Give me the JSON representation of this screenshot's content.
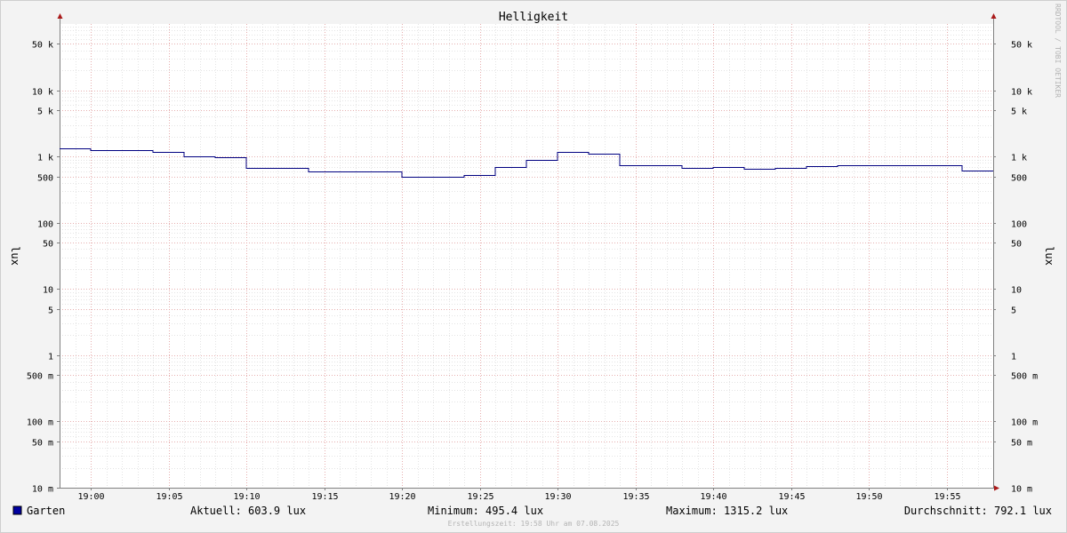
{
  "chart_data": {
    "type": "line",
    "title": "Helligkeit",
    "ylabel": "lux",
    "ylabel_right": "lux",
    "yscale": "log",
    "ylim": [
      0.01,
      100000
    ],
    "xlim": [
      "18:58",
      "19:58"
    ],
    "grid": true,
    "y_ticks": [
      {
        "value": 50000,
        "label": "50 k"
      },
      {
        "value": 10000,
        "label": "10 k"
      },
      {
        "value": 5000,
        "label": "5 k"
      },
      {
        "value": 1000,
        "label": "1 k"
      },
      {
        "value": 500,
        "label": "500"
      },
      {
        "value": 100,
        "label": "100"
      },
      {
        "value": 50,
        "label": "50"
      },
      {
        "value": 10,
        "label": "10"
      },
      {
        "value": 5,
        "label": "5"
      },
      {
        "value": 1,
        "label": "1"
      },
      {
        "value": 0.5,
        "label": "500 m"
      },
      {
        "value": 0.1,
        "label": "100 m"
      },
      {
        "value": 0.05,
        "label": "50 m"
      },
      {
        "value": 0.01,
        "label": "10 m"
      }
    ],
    "x_ticks": [
      "19:00",
      "19:05",
      "19:10",
      "19:15",
      "19:20",
      "19:25",
      "19:30",
      "19:35",
      "19:40",
      "19:45",
      "19:50",
      "19:55"
    ],
    "series": [
      {
        "name": "Garten",
        "color": "#000080",
        "x": [
          "18:58",
          "19:00",
          "19:04",
          "19:06",
          "19:08",
          "19:10",
          "19:14",
          "19:20",
          "19:24",
          "19:26",
          "19:28",
          "19:30",
          "19:32",
          "19:34",
          "19:38",
          "19:40",
          "19:42",
          "19:44",
          "19:46",
          "19:48",
          "19:50",
          "19:52",
          "19:54",
          "19:56"
        ],
        "values": [
          1315.2,
          1240,
          1170,
          1010,
          960,
          680,
          600,
          495.4,
          520,
          690,
          900,
          1180,
          1100,
          740,
          680,
          700,
          660,
          680,
          710,
          740,
          730,
          740,
          730,
          603.9
        ]
      }
    ],
    "legend": {
      "placement": "bottom",
      "swatch_color": "#0000a0",
      "name": "Garten",
      "stats": [
        {
          "label": "Aktuell:",
          "value": "603.9 lux"
        },
        {
          "label": "Minimum:",
          "value": "495.4 lux"
        },
        {
          "label": "Maximum:",
          "value": "1315.2 lux"
        },
        {
          "label": "Durchschnitt:",
          "value": "792.1 lux"
        }
      ]
    },
    "watermark": "RRDTOOL / TOBI OETIKER",
    "footer": "Erstellungszeit: 19:58 Uhr am 07.08.2025",
    "colors": {
      "background": "#f3f3f3",
      "canvas": "#ffffff",
      "major_grid": "#e8a0a0",
      "minor_grid": "#c8c8c8",
      "axis": "#808080",
      "arrow": "#aa1a1a",
      "text": "#000000",
      "muted": "#b4b4b4"
    }
  }
}
